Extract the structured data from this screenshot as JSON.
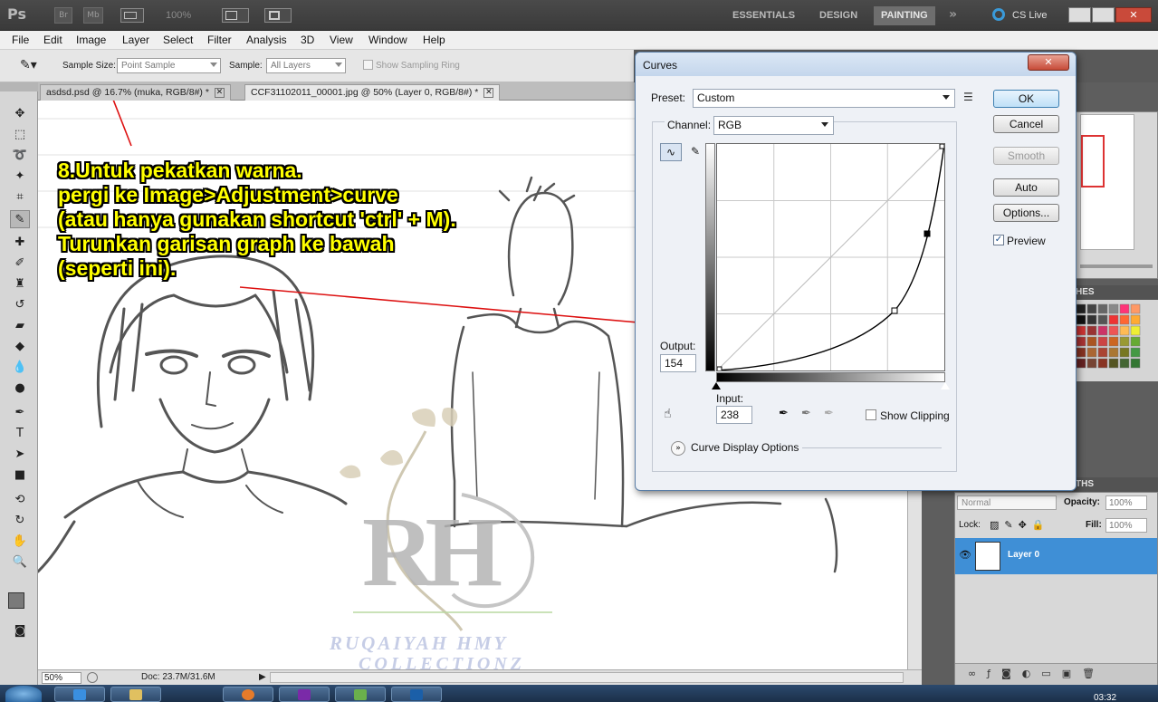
{
  "app": {
    "logo": "Ps",
    "bridge": "Br",
    "minibridge": "Mb",
    "zoom": "100%",
    "workspaces": [
      "ESSENTIALS",
      "DESIGN",
      "PAINTING"
    ],
    "active_workspace": "PAINTING",
    "cslive": "CS Live"
  },
  "menu": [
    "File",
    "Edit",
    "Image",
    "Layer",
    "Select",
    "Filter",
    "Analysis",
    "3D",
    "View",
    "Window",
    "Help"
  ],
  "options_bar": {
    "sample_size_label": "Sample Size:",
    "sample_size_value": "Point Sample",
    "sample_label": "Sample:",
    "sample_value": "All Layers",
    "show_sampling_ring": "Show Sampling Ring"
  },
  "tabs": [
    {
      "label": "asdsd.psd @ 16.7% (muka, RGB/8#) *"
    },
    {
      "label": "CCF31102011_00001.jpg @ 50% (Layer 0, RGB/8#) *"
    }
  ],
  "annotation": {
    "lines": [
      "8.Untuk pekatkan warna.",
      "pergi ke Image>Adjustment>curve",
      "(atau hanya gunakan shortcut 'ctrl' + M).",
      "Turunkan garisan graph ke bawah",
      "(seperti ini)."
    ]
  },
  "watermark": {
    "monogram": "RH",
    "line1": "RUQAIYAH HMY",
    "line2": "COLLECTIONZ"
  },
  "curves": {
    "title": "Curves",
    "preset_label": "Preset:",
    "preset_value": "Custom",
    "channel_label": "Channel:",
    "channel_value": "RGB",
    "output_label": "Output:",
    "output_value": "154",
    "input_label": "Input:",
    "input_value": "238",
    "show_clipping": "Show Clipping",
    "curve_display_options": "Curve Display Options",
    "buttons": {
      "ok": "OK",
      "cancel": "Cancel",
      "smooth": "Smooth",
      "auto": "Auto",
      "options": "Options..."
    },
    "preview_label": "Preview",
    "preview_checked": true
  },
  "status": {
    "zoom": "50%",
    "doc": "Doc: 23.7M/31.6M"
  },
  "layers": {
    "blend_mode": "Normal",
    "opacity_label": "Opacity:",
    "opacity_value": "100%",
    "lock_label": "Lock:",
    "fill_label": "Fill:",
    "fill_value": "100%",
    "layer_name": "Layer 0",
    "paths_tab": "THS",
    "swatches_tab": "HES"
  },
  "taskbar": {
    "clock": "03:32"
  }
}
